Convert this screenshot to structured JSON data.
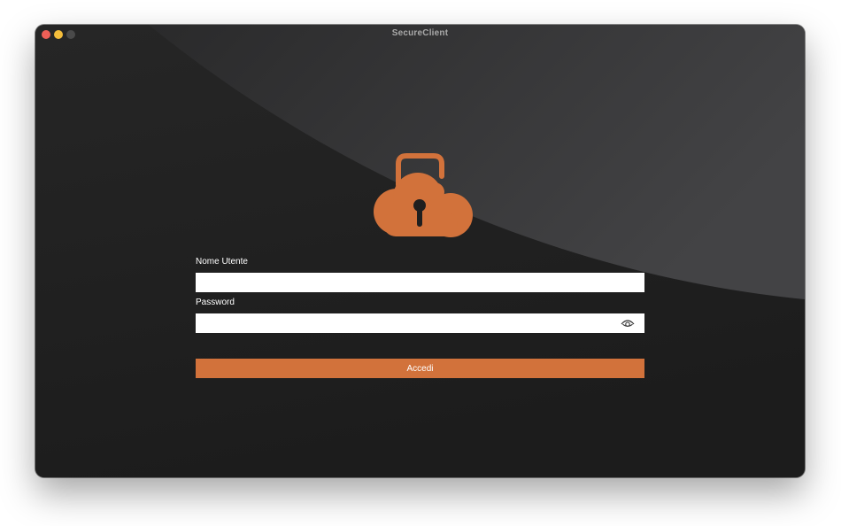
{
  "window": {
    "title": "SecureClient"
  },
  "form": {
    "username_label": "Nome Utente",
    "username_value": "",
    "password_label": "Password",
    "password_value": "",
    "login_button": "Accedi"
  },
  "icons": {
    "logo": "cloud-padlock-icon",
    "show_password": "eye-icon"
  },
  "colors": {
    "accent": "#d2723b",
    "background_dark": "#1f1f1f",
    "background_light": "#3a3a3c"
  }
}
